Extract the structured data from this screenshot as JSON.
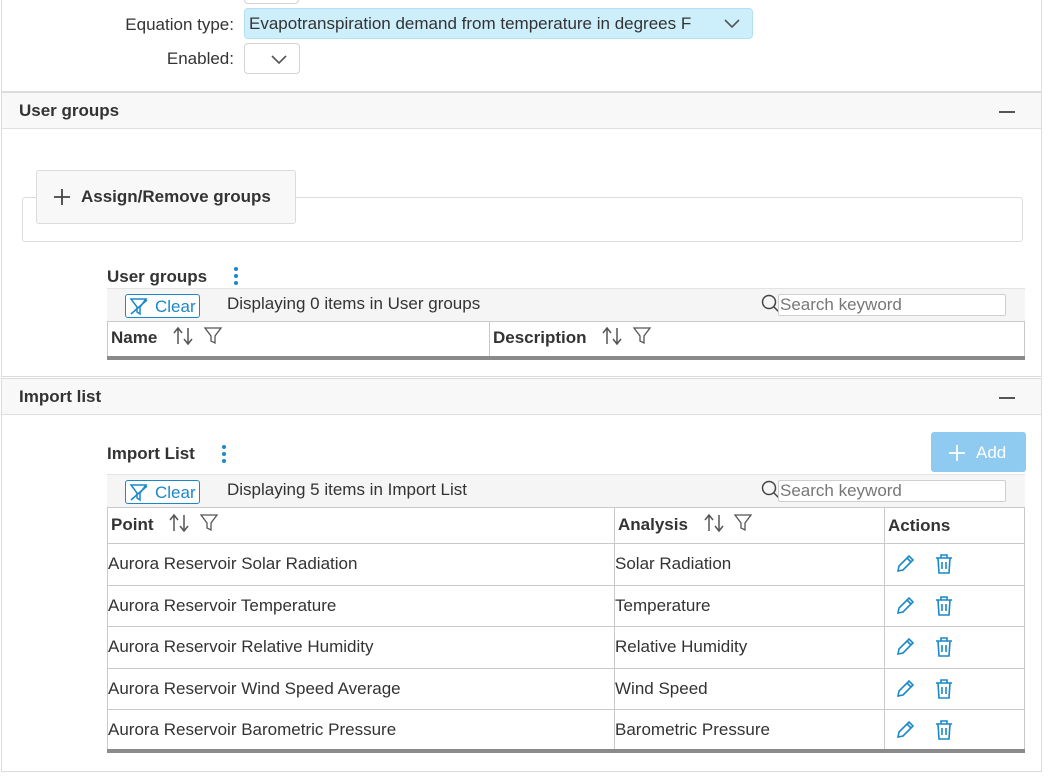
{
  "form": {
    "equation_type_label": "Equation type:",
    "equation_type_value": "Evapotranspiration demand from temperature in degrees F",
    "enabled_label": "Enabled:",
    "enabled_value": ""
  },
  "user_groups_panel": {
    "title": "User groups",
    "assign_button": "Assign/Remove groups",
    "grid_title": "User groups",
    "clear_label": "Clear",
    "display_text": "Displaying 0 items in User groups",
    "search_placeholder": "Search keyword",
    "columns": [
      "Name",
      "Description"
    ]
  },
  "import_panel": {
    "title": "Import list",
    "grid_title": "Import List",
    "add_label": "Add",
    "clear_label": "Clear",
    "display_text": "Displaying 5 items in Import List",
    "search_placeholder": "Search keyword",
    "columns": [
      "Point",
      "Analysis",
      "Actions"
    ],
    "rows": [
      {
        "point": "Aurora Reservoir Solar Radiation",
        "analysis": "Solar Radiation"
      },
      {
        "point": "Aurora Reservoir Temperature",
        "analysis": "Temperature"
      },
      {
        "point": "Aurora Reservoir Relative Humidity",
        "analysis": "Relative Humidity"
      },
      {
        "point": "Aurora Reservoir Wind Speed Average",
        "analysis": "Wind Speed"
      },
      {
        "point": "Aurora Reservoir Barometric Pressure",
        "analysis": "Barometric Pressure"
      }
    ]
  },
  "icons": {
    "clear": "filter-clear-icon",
    "search": "search-icon",
    "sort": "sort-icon",
    "filter": "filter-icon",
    "edit": "edit-icon",
    "delete": "delete-icon",
    "add": "plus-icon",
    "collapse": "minus-icon",
    "menu": "kebab-menu-icon",
    "dropdown": "chevron-down-icon"
  },
  "colors": {
    "accent": "#1a88c9",
    "highlight": "#cdeefb",
    "add_button": "#8fcaf0"
  }
}
